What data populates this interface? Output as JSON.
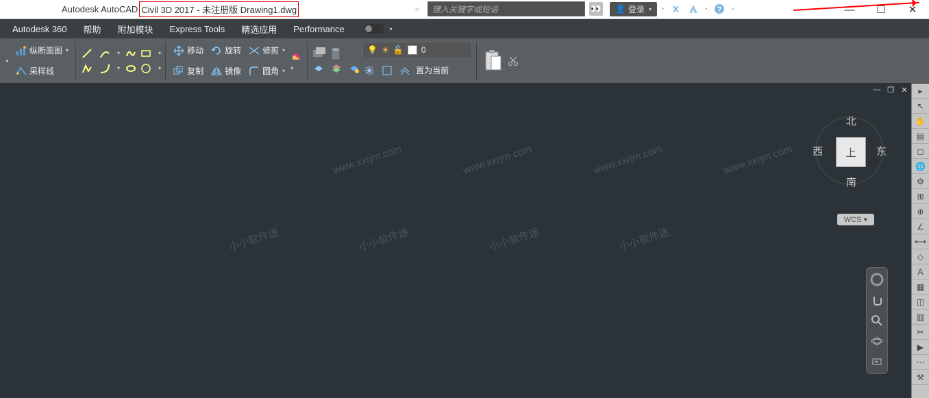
{
  "title": {
    "prefix": "Autodesk AutoCAD",
    "highlighted": " Civil 3D 2017 - 未注册版      Drawing1.dwg"
  },
  "search": {
    "placeholder": "键入关键字或短语"
  },
  "login": {
    "label": "登录"
  },
  "menu": {
    "autodesk360": "Autodesk 360",
    "help": "帮助",
    "addons": "附加模块",
    "express": "Express Tools",
    "featured": "精选应用",
    "performance": "Performance"
  },
  "ribbon": {
    "profile": "纵断面图",
    "sample": "采样线",
    "move": "移动",
    "copy": "复制",
    "rotate": "旋转",
    "mirror": "镜像",
    "trim": "修剪",
    "fillet": "圆角",
    "layer_current": "0",
    "set_current": "置为当前"
  },
  "viewcube": {
    "top": "上",
    "north": "北",
    "south": "南",
    "east": "东",
    "west": "西",
    "wcs": "WCS"
  },
  "watermarks": [
    {
      "zh": "小小软件迷",
      "url": "www.xxrjm.com"
    },
    {
      "zh": "小小软件迷",
      "url": "www.xxrjm.com"
    },
    {
      "zh": "小小软件迷",
      "url": "www.xxrjm.com"
    },
    {
      "zh": "小小软件迷",
      "url": "www.xxrjm.com"
    }
  ]
}
